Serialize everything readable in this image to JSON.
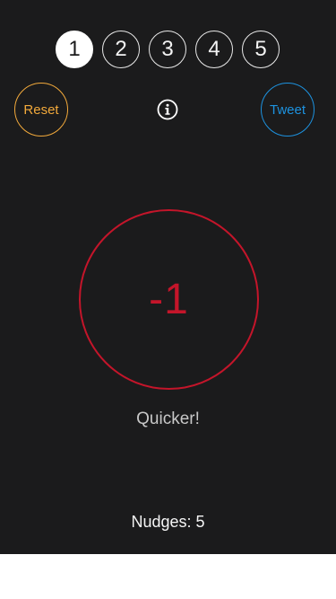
{
  "levels": {
    "items": [
      {
        "label": "1",
        "selected": true
      },
      {
        "label": "2",
        "selected": false
      },
      {
        "label": "3",
        "selected": false
      },
      {
        "label": "4",
        "selected": false
      },
      {
        "label": "5",
        "selected": false
      }
    ]
  },
  "controls": {
    "reset_label": "Reset",
    "tweet_label": "Tweet",
    "info_icon": "info-icon"
  },
  "game": {
    "counter": "-1",
    "hint": "Quicker!",
    "nudges_text": "Nudges: 5"
  },
  "colors": {
    "background": "#1b1b1c",
    "reset_accent": "#f2a93b",
    "tweet_accent": "#1d92df",
    "counter_accent": "#c4152a"
  }
}
